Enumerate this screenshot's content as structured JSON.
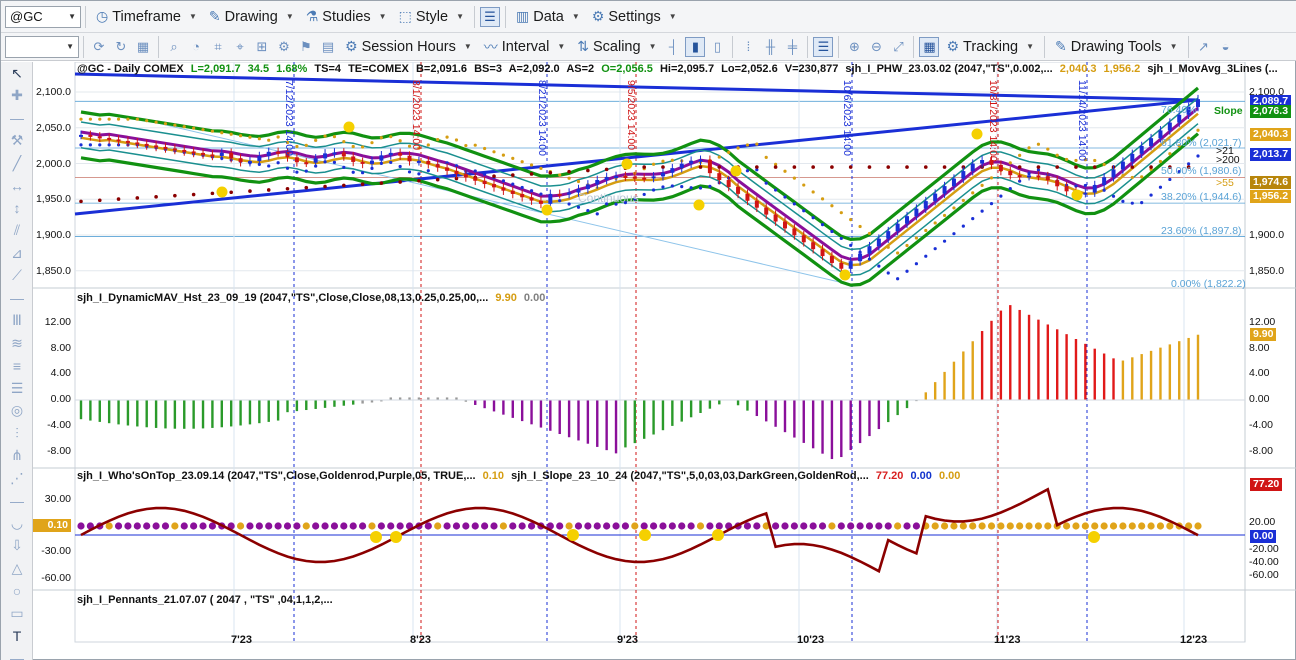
{
  "toolbar1": {
    "symbol": "@GC",
    "items": [
      {
        "label": "Timeframe",
        "icon": "clock-icon"
      },
      {
        "label": "Drawing",
        "icon": "pencil-icon"
      },
      {
        "label": "Studies",
        "icon": "flask-icon"
      },
      {
        "label": "Style",
        "icon": "style-icon"
      },
      {
        "label": "Data",
        "icon": "data-icon"
      },
      {
        "label": "Settings",
        "icon": "gear-icon"
      }
    ]
  },
  "toolbar2": {
    "items": [
      {
        "label": "Session Hours",
        "icon": "session-icon"
      },
      {
        "label": "Interval",
        "icon": "interval-icon"
      },
      {
        "label": "Scaling",
        "icon": "scaling-icon"
      },
      {
        "label": "Tracking",
        "icon": "tracking-icon"
      },
      {
        "label": "Drawing Tools",
        "icon": "drawing-tools-icon"
      }
    ]
  },
  "price_panel": {
    "header": {
      "symbol": "@GC - Daily  COMEX",
      "L": "L=2,091.7",
      "chg": "34.5",
      "pct": "1.68%",
      "ts": "TS=4",
      "te": "TE=COMEX",
      "b": "B=2,091.6",
      "bs": "BS=3",
      "a": "A=2,092.0",
      "as": "AS=2",
      "o": "O=2,056.5",
      "hi": "Hi=2,095.7",
      "lo": "Lo=2,052.6",
      "v": "V=230,877",
      "study1": "sjh_I_PHW_23.03.02 (2047,\"TS\",0.002,...",
      "v1": "2,040.3",
      "v2": "1,956.2",
      "study2": "sjh_I_MovAvg_3Lines (..."
    },
    "y_ticks": [
      "2,100.0",
      "2,050.0",
      "2,000.0",
      "1,950.0",
      "1,900.0",
      "1,850.0"
    ],
    "right_ticks": [
      "2,100.0",
      "1,900.0",
      "1,850.0"
    ],
    "fib_labels": [
      "76.40%",
      "61.80% (2,021.7)",
      "50.00% (1,980.6)",
      "38.20% (1,944.6)",
      "23.60% (1,897.8)",
      "0.00% (1,822.2)"
    ],
    "slope_label": "Slope",
    "price_tags": [
      {
        "text": "2,089.7",
        "color": "#1a2fd6"
      },
      {
        "text": "2,076.3",
        "color": "#119111"
      },
      {
        "text": "2,040.3",
        "color": "#e0a41a"
      },
      {
        "text": "2,013.7",
        "color": "#1a2fd6"
      },
      {
        "text": "1,974.6",
        "color": "#b8860b"
      },
      {
        "text": "1,956.2",
        "color": "#e0a41a"
      }
    ],
    "side_text": [
      ">21",
      ">200",
      ">55"
    ],
    "date_marks": [
      "7/12/2023 14:00",
      "8/1/2023 14:00",
      "8/21/2023 14:00",
      "9/5/2023 14:00",
      "10/6/2023 14:00",
      "10/31/2023 14:00",
      "11/14/2023 14:00"
    ],
    "watermark": "Continuous"
  },
  "histogram_panel": {
    "title": "sjh_I_DynamicMAV_Hst_23_09_19 (2047,\"TS\",Close,Close,08,13,0.25,0.25,00,...",
    "v1": "9.90",
    "v2": "0.00",
    "y_ticks": [
      "12.00",
      "8.00",
      "4.00",
      "0.00",
      "-4.00",
      "-8.00"
    ],
    "tag": "9.90"
  },
  "osc_panel": {
    "title1": "sjh_I_Who'sOnTop_23.09.14 (2047,\"TS\",Close,Goldenrod,Purple,05,  TRUE,...",
    "v1": "0.10",
    "title2": "sjh_I_Slope_23_10_24 (2047,\"TS\",5,0,03,03,DarkGreen,GoldenRod,...",
    "v2": "77.20",
    "v3": "0.00",
    "v4": "0.00",
    "y_ticks_left": [
      "30.00",
      "-30.00",
      "-60.00"
    ],
    "left_tag": "0.10",
    "y_ticks_right": [
      "20.00",
      "-20.00",
      "-40.00",
      "-60.00"
    ],
    "tag_red": "77.20",
    "tag_blue": "0.00"
  },
  "pennant_panel": {
    "title": "sjh_I_Pennants_21.07.07 (  2047 ,  \"TS\" ,04,1,1,2,..."
  },
  "x_axis": [
    "7'23",
    "8'23",
    "9'23",
    "10'23",
    "11'23",
    "12'23"
  ],
  "colors": {
    "down": "#d01515",
    "up": "#119111",
    "trend": "#1a2fd6",
    "gold": "#e0a41a",
    "purple": "#8a0f9a"
  }
}
